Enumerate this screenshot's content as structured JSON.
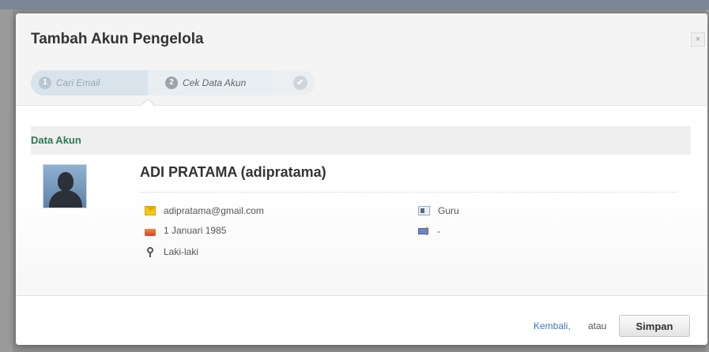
{
  "modal": {
    "title": "Tambah Akun Pengelola",
    "close_label": "×"
  },
  "wizard": {
    "steps": [
      {
        "number": "1",
        "label": "Cari Email",
        "state": "done"
      },
      {
        "number": "2",
        "label": "Cek Data Akun",
        "state": "active"
      },
      {
        "number": "",
        "label": "✔",
        "state": "pending"
      }
    ]
  },
  "section": {
    "title": "Data Akun"
  },
  "account": {
    "display_name": "ADI PRATAMA (adipratama)",
    "email": "adipratama@gmail.com",
    "birth_date": "1 Januari 1985",
    "gender": "Laki-laki",
    "role": "Guru",
    "other": "-"
  },
  "icons": {
    "email": "envelope-icon",
    "birth_date": "cake-icon",
    "gender": "gender-icon",
    "role": "id-card-icon",
    "other": "flag-icon",
    "avatar": "default-user-avatar"
  },
  "footer": {
    "back_label": "Kembali,",
    "or_label": "atau",
    "save_label": "Simpan"
  },
  "colors": {
    "section_title": "#2a7a55",
    "link": "#3b78c2",
    "overlay": "#8d8d8d"
  }
}
